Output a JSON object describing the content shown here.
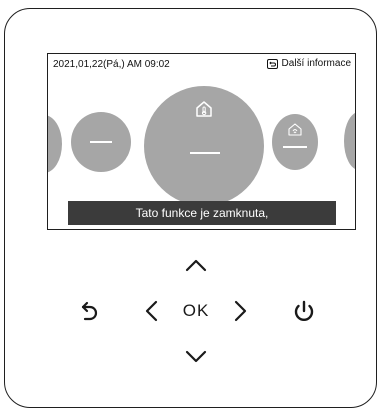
{
  "screen": {
    "datetime": "2021,01,22(Pá,) AM 09:02",
    "more_info_label": "Další informace",
    "toast": "Tato funkce je zamknuta,"
  },
  "icons": {
    "back_box": "return-arrow-icon",
    "center_mode": "home-thermometer-icon",
    "right_mode": "home-fan-icon",
    "up": "chevron-up-icon",
    "down": "chevron-down-icon",
    "left": "chevron-left-icon",
    "right": "chevron-right-icon",
    "back": "back-arrow-icon",
    "power": "power-icon"
  },
  "keypad": {
    "ok_label": "OK"
  },
  "colors": {
    "circle": "#a6a6a6",
    "toast_bg": "#3b3b3b",
    "border": "#1f1f1f"
  }
}
